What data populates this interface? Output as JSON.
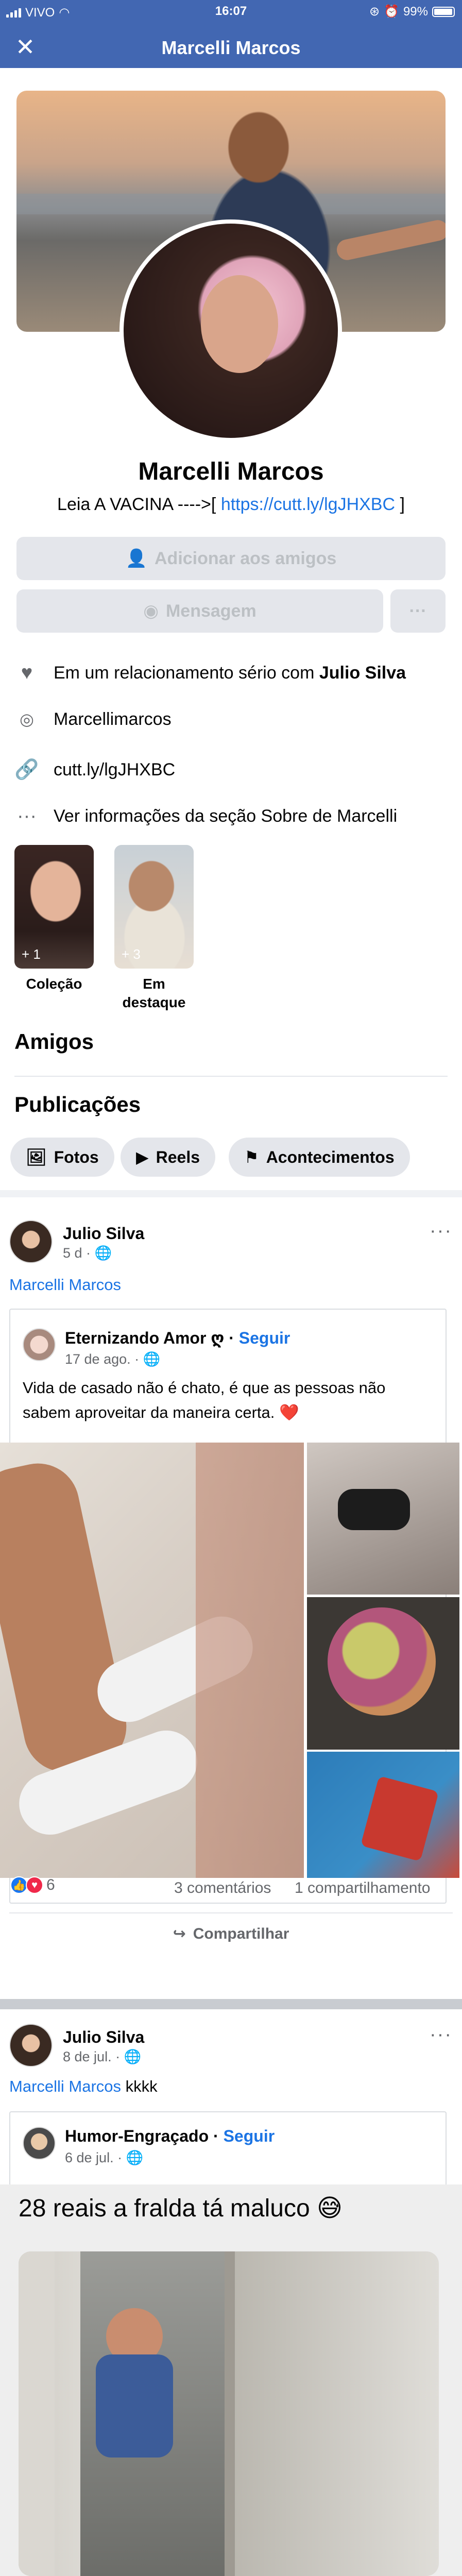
{
  "status": {
    "carrier": "VIVO",
    "time": "16:07",
    "battery": "99%"
  },
  "header": {
    "title": "Marcelli Marcos"
  },
  "profile": {
    "name": "Marcelli Marcos",
    "bio_prefix": "Leia  A VACINA ---->[ ",
    "bio_link": "https://cutt.ly/lgJHXBC",
    "bio_suffix": " ]",
    "add_friend_label": "Adicionar aos amigos",
    "message_label": "Mensagem",
    "more_label": "···"
  },
  "about": {
    "relationship_prefix": "Em um relacionamento sério com ",
    "relationship_partner": "Julio Silva",
    "instagram": "Marcellimarcos",
    "website": "cutt.ly/lgJHXBC",
    "see_more": "Ver informações da seção Sobre de Marcelli"
  },
  "highlights": [
    {
      "count": "+ 1",
      "label": "Coleção"
    },
    {
      "count": "+ 3",
      "label": "Em destaque"
    }
  ],
  "sections": {
    "friends": "Amigos",
    "posts": "Publicações"
  },
  "filters": [
    "Fotos",
    "Reels",
    "Acontecimentos"
  ],
  "post1": {
    "author": "Julio Silva",
    "time": "5 d",
    "target": "Marcelli Marcos",
    "shared_author": "Eternizando Amor ღ",
    "follow": "Seguir",
    "shared_time": "17 de ago.",
    "shared_text": "Vida de casado não é chato, é que as pessoas não sabem aproveitar da maneira certa. ❤️",
    "reaction_count": "6",
    "comments": "3 comentários",
    "shares": "1 compartilhamento",
    "share_label": "Compartilhar"
  },
  "post2": {
    "author": "Julio Silva",
    "time": "8 de jul.",
    "target": "Marcelli Marcos",
    "text_suffix": " kkkk",
    "shared_author": "Humor-Engraçado",
    "follow": "Seguir",
    "shared_time": "6 de jul.",
    "big_text": "28 reais a fralda tá maluco 😅"
  }
}
